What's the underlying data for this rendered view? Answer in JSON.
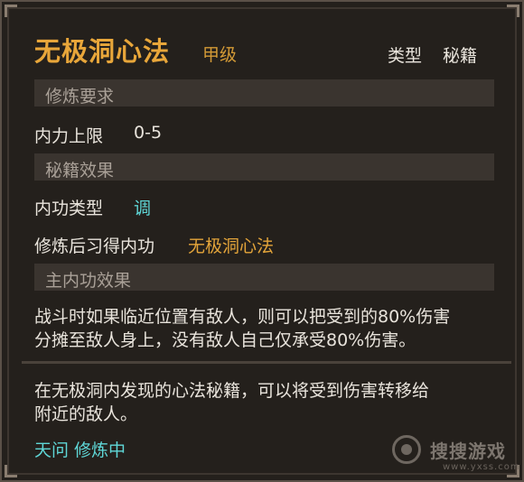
{
  "header": {
    "name": "无极洞心法",
    "grade": "甲级",
    "type_label": "类型",
    "type_value": "秘籍"
  },
  "requirements": {
    "section_title": "修炼要求",
    "label": "内力上限",
    "value": "0-5"
  },
  "effects": {
    "section_title": "秘籍效果",
    "kind_label": "内功类型",
    "kind_value": "调",
    "learn_label": "修炼后习得内功",
    "learn_value": "无极洞心法"
  },
  "main_effect": {
    "section_title": "主内功效果",
    "line1": "战斗时如果临近位置有敌人，则可以把受到的80%伤害",
    "line2": "分摊至敌人身上，没有敌人自己仅承受80%伤害。"
  },
  "description": {
    "line1": "在无极洞内发现的心法秘籍，可以将受到伤害转移给",
    "line2": "附近的敌人。"
  },
  "status": "天问 修炼中",
  "watermark": {
    "text": "搜搜游戏",
    "url": "www.yxss.com"
  }
}
